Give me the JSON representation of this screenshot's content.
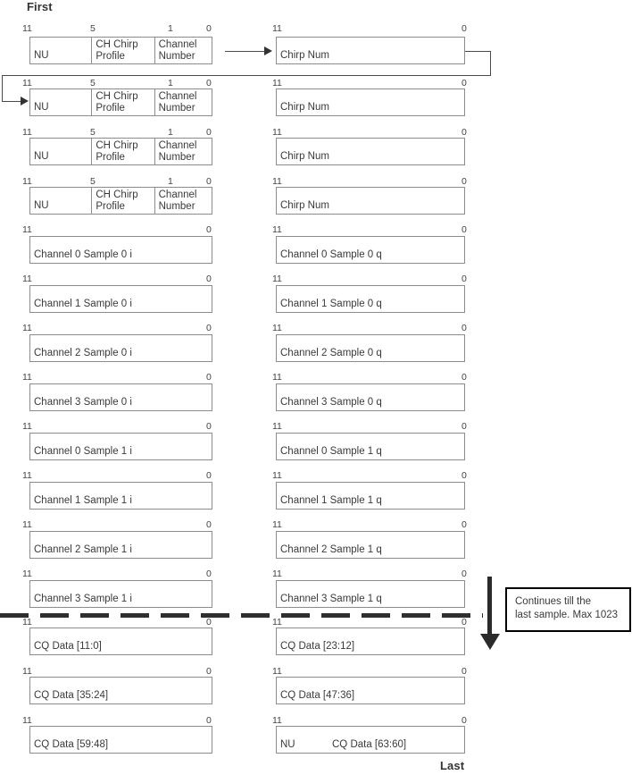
{
  "diagram": {
    "first_label": "First",
    "last_label": "Last",
    "bit_labels": {
      "msb": "11",
      "five": "5",
      "one": "1",
      "lsb": "0"
    },
    "callout": {
      "text": "Continues till the\nlast sample. Max 1023"
    },
    "header_rows": [
      {
        "left": {
          "cells": [
            {
              "text": "NU",
              "lines": 1
            },
            {
              "text": "CH Chirp\nProfile",
              "lines": 2
            },
            {
              "text": "Channel\nNumber",
              "lines": 2
            }
          ]
        },
        "right": {
          "cells": [
            {
              "text": "Chirp Num",
              "lines": 1
            }
          ]
        }
      },
      {
        "left": {
          "cells": [
            {
              "text": "NU",
              "lines": 1
            },
            {
              "text": "CH Chirp\nProfile",
              "lines": 2
            },
            {
              "text": "Channel\nNumber",
              "lines": 2
            }
          ]
        },
        "right": {
          "cells": [
            {
              "text": "Chirp Num",
              "lines": 1
            }
          ]
        }
      },
      {
        "left": {
          "cells": [
            {
              "text": "NU",
              "lines": 1
            },
            {
              "text": "CH Chirp\nProfile",
              "lines": 2
            },
            {
              "text": "Channel\nNumber",
              "lines": 2
            }
          ]
        },
        "right": {
          "cells": [
            {
              "text": "Chirp Num",
              "lines": 1
            }
          ]
        }
      },
      {
        "left": {
          "cells": [
            {
              "text": "NU",
              "lines": 1
            },
            {
              "text": "CH Chirp\nProfile",
              "lines": 2
            },
            {
              "text": "Channel\nNumber",
              "lines": 2
            }
          ]
        },
        "right": {
          "cells": [
            {
              "text": "Chirp Num",
              "lines": 1
            }
          ]
        }
      }
    ],
    "sample_rows": [
      {
        "left": "Channel 0 Sample 0 i",
        "right": "Channel 0 Sample 0 q"
      },
      {
        "left": "Channel 1 Sample 0 i",
        "right": "Channel 1 Sample 0 q"
      },
      {
        "left": "Channel 2 Sample 0 i",
        "right": "Channel 2 Sample 0 q"
      },
      {
        "left": "Channel 3 Sample 0 i",
        "right": "Channel 3 Sample 0 q"
      },
      {
        "left": "Channel 0 Sample 1 i",
        "right": "Channel 0 Sample 1 q"
      },
      {
        "left": "Channel 1 Sample 1 i",
        "right": "Channel 1 Sample 1 q"
      },
      {
        "left": "Channel 2 Sample 1 i",
        "right": "Channel 2 Sample 1 q"
      },
      {
        "left": "Channel 3 Sample 1 i",
        "right": "Channel 3 Sample 1 q"
      }
    ],
    "cq_rows": [
      {
        "left": "CQ Data [11:0]",
        "right": "CQ Data [23:12]"
      },
      {
        "left": "CQ Data [35:24]",
        "right": "CQ Data [47:36]"
      },
      {
        "left": "CQ Data [59:48]",
        "right_prefix": "NU",
        "right": "CQ Data [63:60]"
      }
    ]
  }
}
